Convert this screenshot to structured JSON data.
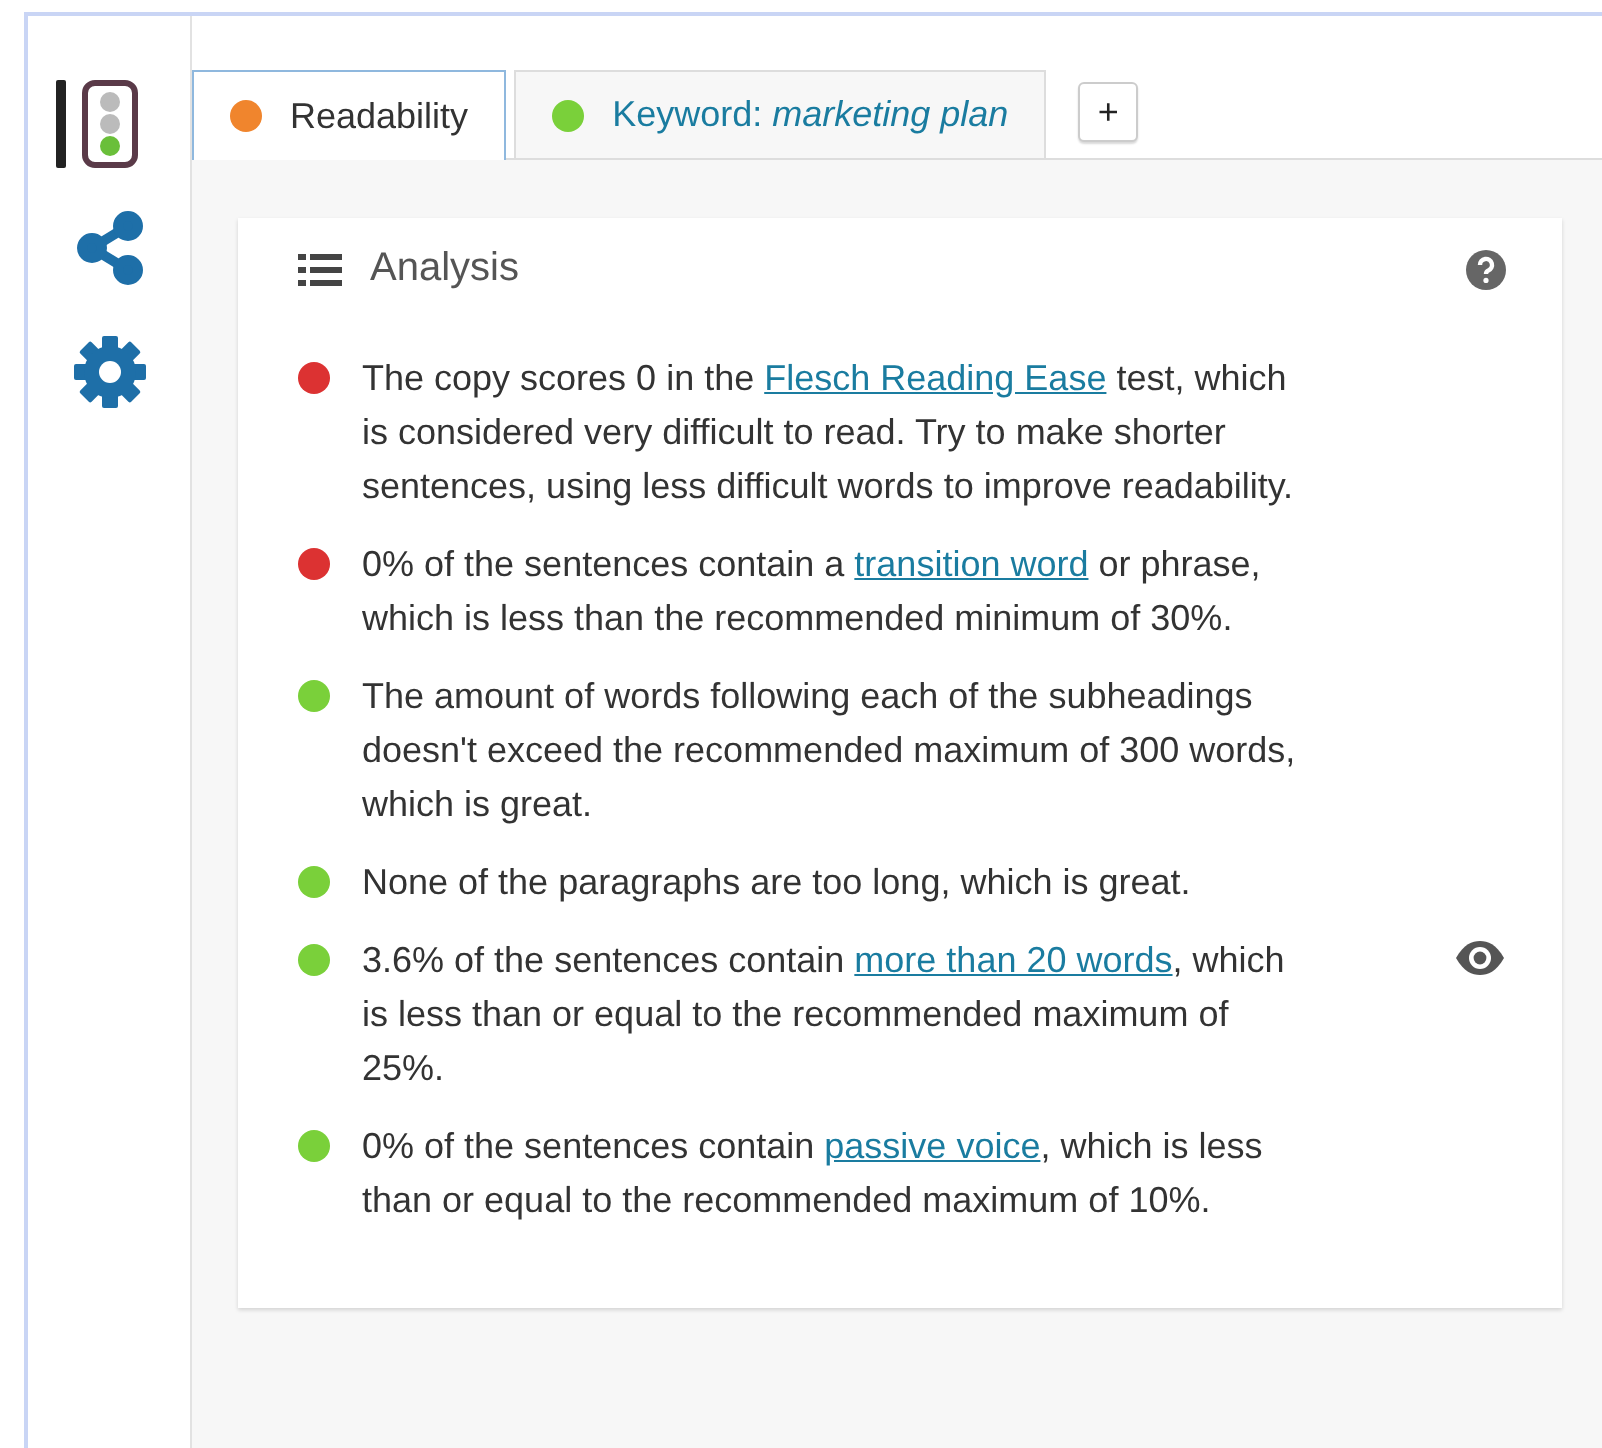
{
  "sidebar": {
    "items": [
      {
        "kind": "traffic-light",
        "selected": true
      },
      {
        "kind": "share",
        "selected": false
      },
      {
        "kind": "settings",
        "selected": false
      }
    ]
  },
  "tabs": [
    {
      "label": "Readability",
      "color": "#f0852d",
      "selected": true
    },
    {
      "label": "Keyword: *marketing plan*",
      "color": "#7ad03a",
      "selected": false
    }
  ],
  "add_tab_button": "+",
  "analysis": {
    "title": "Analysis",
    "items": [
      {
        "color": "#dc3232",
        "highlight_button": false,
        "segments": [
          {
            "kind": "text",
            "text": "The copy scores 0 in the "
          },
          {
            "kind": "link",
            "text": "Flesch Reading Ease"
          },
          {
            "kind": "text",
            "text": " test, which is considered very difficult to read. Try to make shorter sentences, using less difficult words to improve readability."
          }
        ]
      },
      {
        "color": "#dc3232",
        "highlight_button": false,
        "segments": [
          {
            "kind": "text",
            "text": "0% of the sentences contain a "
          },
          {
            "kind": "link",
            "text": "transition word"
          },
          {
            "kind": "text",
            "text": " or phrase, which is less than the recommended minimum of 30%."
          }
        ]
      },
      {
        "color": "#7ad03a",
        "highlight_button": false,
        "segments": [
          {
            "kind": "text",
            "text": "The amount of words following each of the subheadings doesn't exceed the recommended maximum of 300 words, which is great."
          }
        ]
      },
      {
        "color": "#7ad03a",
        "highlight_button": false,
        "segments": [
          {
            "kind": "text",
            "text": "None of the paragraphs are too long, which is great."
          }
        ]
      },
      {
        "color": "#7ad03a",
        "highlight_button": true,
        "segments": [
          {
            "kind": "text",
            "text": "3.6% of the sentences contain "
          },
          {
            "kind": "link",
            "text": "more than 20 words"
          },
          {
            "kind": "text",
            "text": ", which is less than or equal to the recommended maximum of 25%."
          }
        ]
      },
      {
        "color": "#7ad03a",
        "highlight_button": false,
        "segments": [
          {
            "kind": "text",
            "text": "0% of the sentences contain "
          },
          {
            "kind": "link",
            "text": "passive voice"
          },
          {
            "kind": "text",
            "text": ", which is less than or equal to the recommended maximum of 10%."
          }
        ]
      }
    ]
  }
}
